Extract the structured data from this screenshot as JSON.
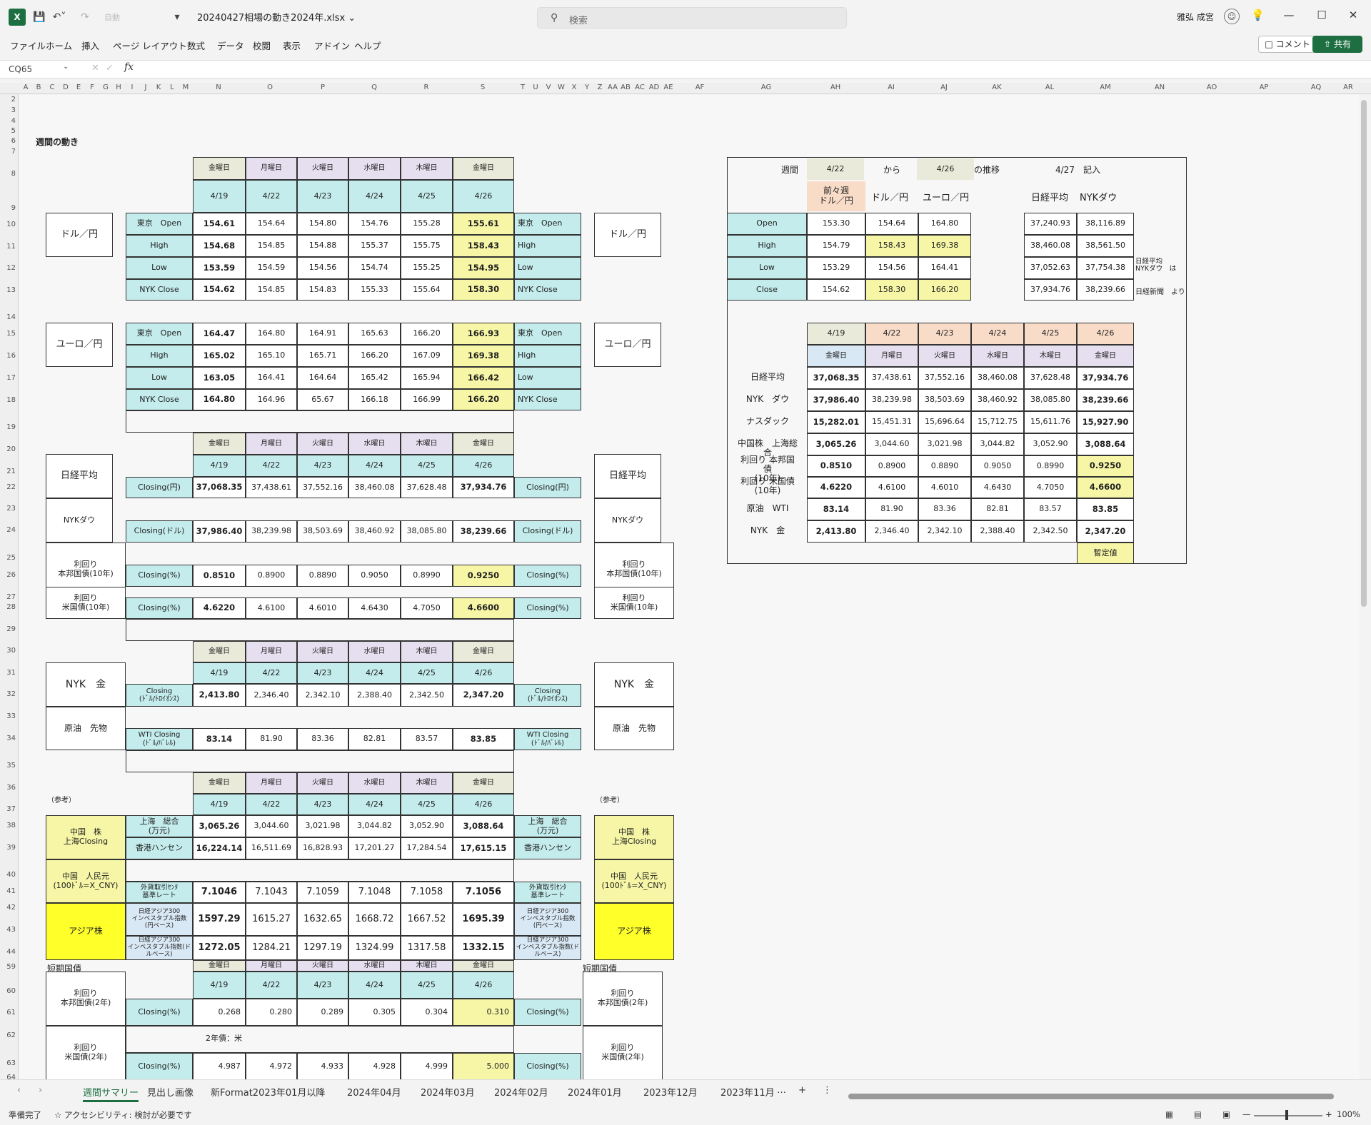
{
  "app": {
    "title": "20240427相場の動き2024年.xlsx",
    "search_placeholder": "検索",
    "user": "雅弘 成宮",
    "qat_mode": "自動",
    "menu": [
      "ファイル",
      "ホーム",
      "挿入",
      "ページ レイアウト",
      "数式",
      "データ",
      "校閲",
      "表示",
      "アドイン",
      "ヘルプ"
    ],
    "comment_label": "コメント",
    "share_label": "共有",
    "namebox": "CQ65",
    "fx": "fx"
  },
  "columns": [
    "A",
    "B",
    "C",
    "D",
    "E",
    "F",
    "G",
    "H",
    "I",
    "J",
    "K",
    "L",
    "M",
    "N",
    "O",
    "P",
    "Q",
    "R",
    "S",
    "T",
    "U",
    "V",
    "W",
    "X",
    "Y",
    "Z",
    "AA",
    "AB",
    "AC",
    "AD",
    "AE",
    "AF",
    "AG",
    "AH",
    "AI",
    "AJ",
    "AK",
    "AL",
    "AM",
    "AN",
    "AO",
    "AP",
    "AQ",
    "AR"
  ],
  "rows": [
    "2",
    "3",
    "4",
    "5",
    "6",
    "7",
    "8",
    "9",
    "10",
    "11",
    "12",
    "13",
    "14",
    "15",
    "16",
    "17",
    "18",
    "19",
    "20",
    "21",
    "22",
    "23",
    "24",
    "25",
    "26",
    "27",
    "28",
    "29",
    "30",
    "31",
    "32",
    "33",
    "34",
    "35",
    "36",
    "37",
    "38",
    "39",
    "40",
    "41",
    "42",
    "43",
    "44",
    "59",
    "60",
    "61",
    "62",
    "63",
    "64"
  ],
  "sheet": {
    "heading": "週間の動き",
    "days": [
      "金曜日",
      "月曜日",
      "火曜日",
      "水曜日",
      "木曜日",
      "金曜日"
    ],
    "dates": [
      "4/19",
      "4/22",
      "4/23",
      "4/24",
      "4/25",
      "4/26"
    ],
    "labels": {
      "usd_jpy": "ドル／円",
      "eur_jpy": "ユーロ／円",
      "nikkei": "日経平均",
      "nyk_dow": "NYKダウ",
      "jgb10": "利回り\n本邦国債(10年)",
      "ust10": "利回り\n米国債(10年)",
      "gold": "NYK　金",
      "oil": "原油　先物",
      "ref": "（参考）",
      "china": "中国　株\n上海Closing",
      "cny": "中国　人民元\n(100ﾄﾞﾙ=X_CNY)",
      "asia": "アジア株",
      "short_bonds": "短期国債",
      "jgb2": "利回り\n本邦国債(2年)",
      "ust2": "利回り\n米国債(2年)",
      "us2_note": "2年債：米"
    },
    "fx_rows": [
      "東京　Open",
      "High",
      "Low",
      "NYK Close"
    ],
    "fx_rows_right": [
      "東京　Open",
      "High",
      "Low",
      "NYK Close"
    ],
    "usd": [
      [
        "154.61",
        "154.64",
        "154.80",
        "154.76",
        "155.28",
        "155.61"
      ],
      [
        "154.68",
        "154.85",
        "154.88",
        "155.37",
        "155.75",
        "158.43"
      ],
      [
        "153.59",
        "154.59",
        "154.56",
        "154.74",
        "155.25",
        "154.95"
      ],
      [
        "154.62",
        "154.85",
        "154.83",
        "155.33",
        "155.64",
        "158.30"
      ]
    ],
    "eur": [
      [
        "164.47",
        "164.80",
        "164.91",
        "165.63",
        "166.20",
        "166.93"
      ],
      [
        "165.02",
        "165.10",
        "165.71",
        "166.20",
        "167.09",
        "169.38"
      ],
      [
        "163.05",
        "164.41",
        "164.64",
        "165.42",
        "165.94",
        "166.42"
      ],
      [
        "164.80",
        "164.96",
        "65.67",
        "166.18",
        "166.99",
        "166.20"
      ]
    ],
    "closing_yen": "Closing(円)",
    "closing_usd": "Closing(ドル)",
    "closing_pct": "Closing(%)",
    "nikkei_vals": [
      "37,068.35",
      "37,438.61",
      "37,552.16",
      "38,460.08",
      "37,628.48",
      "37,934.76"
    ],
    "dow_vals": [
      "37,986.40",
      "38,239.98",
      "38,503.69",
      "38,460.92",
      "38,085.80",
      "38,239.66"
    ],
    "jgb10_vals": [
      "0.8510",
      "0.8900",
      "0.8890",
      "0.9050",
      "0.8990",
      "0.9250"
    ],
    "ust10_vals": [
      "4.6220",
      "4.6100",
      "4.6010",
      "4.6430",
      "4.7050",
      "4.6600"
    ],
    "gold_label": "Closing\n(ﾄﾞﾙ/ﾄﾛｲｵﾝｽ)",
    "gold_vals": [
      "2,413.80",
      "2,346.40",
      "2,342.10",
      "2,388.40",
      "2,342.50",
      "2,347.20"
    ],
    "oil_label": "WTI Closing\n(ﾄﾞﾙ/ﾊﾞﾚﾙ)",
    "oil_vals": [
      "83.14",
      "81.90",
      "83.36",
      "82.81",
      "83.57",
      "83.85"
    ],
    "shanghai_label": "上海　総合\n(万元)",
    "shanghai_vals": [
      "3,065.26",
      "3,044.60",
      "3,021.98",
      "3,044.82",
      "3,052.90",
      "3,088.64"
    ],
    "hk_label": "香港ハンセン",
    "hk_vals": [
      "16,224.14",
      "16,511.69",
      "16,828.93",
      "17,201.27",
      "17,284.54",
      "17,615.15"
    ],
    "cny_label": "外貨取引ｾﾝﾀ\n基準レート",
    "cny_vals": [
      "7.1046",
      "7.1043",
      "7.1059",
      "7.1048",
      "7.1058",
      "7.1056"
    ],
    "asia_yen_label": "日経アジア300\nインベスタブル指数\n(円ベース)",
    "asia_yen_vals": [
      "1597.29",
      "1615.27",
      "1632.65",
      "1668.72",
      "1667.52",
      "1695.39"
    ],
    "asia_usd_label": "日経アジア300\nインベスタブル指数(ド\nルベース)",
    "asia_usd_vals": [
      "1272.05",
      "1284.21",
      "1297.19",
      "1324.99",
      "1317.58",
      "1332.15"
    ],
    "jgb2_vals": [
      "0.268",
      "0.280",
      "0.289",
      "0.305",
      "0.304",
      "0.310"
    ],
    "ust2_vals": [
      "4.987",
      "4.972",
      "4.933",
      "4.928",
      "4.999",
      "5.000"
    ]
  },
  "summary": {
    "week": "週間",
    "from_date": "4/22",
    "from": "から",
    "to_date": "4/26",
    "trend": "の推移",
    "entry": "4/27　記入",
    "col_prev": "前々週\nドル／円",
    "col_usd": "ドル／円",
    "col_eur": "ユーロ／円",
    "col_nikkei": "日経平均",
    "col_dow": "NYKダウ",
    "rows": [
      "Open",
      "High",
      "Low",
      "Close"
    ],
    "fx": [
      [
        "153.30",
        "154.64",
        "164.80"
      ],
      [
        "154.79",
        "158.43",
        "169.38"
      ],
      [
        "153.29",
        "154.56",
        "164.41"
      ],
      [
        "154.62",
        "158.30",
        "166.20"
      ]
    ],
    "idx": [
      [
        "37,240.93",
        "38,116.89"
      ],
      [
        "38,460.08",
        "38,561.50"
      ],
      [
        "37,052.63",
        "37,754.38"
      ],
      [
        "37,934.76",
        "38,239.66"
      ]
    ],
    "note1": "日経平均\nNYKダウ　は",
    "note2": "日経新聞　より",
    "table_labels": [
      "日経平均",
      "NYK　ダウ",
      "ナスダック",
      "中国株　上海総合",
      "利回り 本邦国債\n(10年)",
      "利回り 米国債\n(10年)",
      "原油　WTI",
      "NYK　金"
    ],
    "table": [
      [
        "37,068.35",
        "37,438.61",
        "37,552.16",
        "38,460.08",
        "37,628.48",
        "37,934.76"
      ],
      [
        "37,986.40",
        "38,239.98",
        "38,503.69",
        "38,460.92",
        "38,085.80",
        "38,239.66"
      ],
      [
        "15,282.01",
        "15,451.31",
        "15,696.64",
        "15,712.75",
        "15,611.76",
        "15,927.90"
      ],
      [
        "3,065.26",
        "3,044.60",
        "3,021.98",
        "3,044.82",
        "3,052.90",
        "3,088.64"
      ],
      [
        "0.8510",
        "0.8900",
        "0.8890",
        "0.9050",
        "0.8990",
        "0.9250"
      ],
      [
        "4.6220",
        "4.6100",
        "4.6010",
        "4.6430",
        "4.7050",
        "4.6600"
      ],
      [
        "83.14",
        "81.90",
        "83.36",
        "82.81",
        "83.57",
        "83.85"
      ],
      [
        "2,413.80",
        "2,346.40",
        "2,342.10",
        "2,388.40",
        "2,342.50",
        "2,347.20"
      ]
    ],
    "provisional": "暫定値"
  },
  "tabs": [
    "週間サマリー",
    "見出し画像",
    "新Format2023年01月以降",
    "2024年04月",
    "2024年03月",
    "2024年02月",
    "2024年01月",
    "2023年12月",
    "2023年11月"
  ],
  "tab_more": "…",
  "tab_add": "+",
  "status": {
    "ready": "準備完了",
    "accessibility": "アクセシビリティ: 検討が必要です",
    "zoom": "100%"
  }
}
